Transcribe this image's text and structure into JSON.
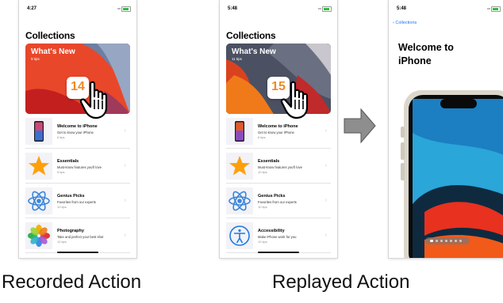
{
  "recorded": {
    "time": "4:27",
    "title": "Collections",
    "hero": {
      "title": "What's New",
      "subtitle": "9 tips",
      "badge": "14"
    },
    "rows": [
      {
        "title": "Welcome to iPhone",
        "subtitle": "Get to know your iPhone",
        "tips": "6 tips",
        "icon": "iphone-icon"
      },
      {
        "title": "Essentials",
        "subtitle": "Must-know features you'll love",
        "tips": "9 tips",
        "icon": "star-icon"
      },
      {
        "title": "Genius Picks",
        "subtitle": "Favorites from our experts",
        "tips": "10 tips",
        "icon": "atom-icon"
      },
      {
        "title": "Photography",
        "subtitle": "Take and perfect your best shot",
        "tips": "10 tips",
        "icon": "photos-icon"
      }
    ]
  },
  "replayed": {
    "time": "5:48",
    "title": "Collections",
    "hero": {
      "title": "What's New",
      "subtitle": "11 tips",
      "badge": "15"
    },
    "rows": [
      {
        "title": "Welcome to iPhone",
        "subtitle": "Get to know your iPhone",
        "tips": "6 tips",
        "icon": "iphone-icon"
      },
      {
        "title": "Essentials",
        "subtitle": "Must-know features you'll love",
        "tips": "10 tips",
        "icon": "star-icon"
      },
      {
        "title": "Genius Picks",
        "subtitle": "Favorites from our experts",
        "tips": "10 tips",
        "icon": "atom-icon"
      },
      {
        "title": "Accessibility",
        "subtitle": "Make iPhone work for you",
        "tips": "10 tips",
        "icon": "accessibility-icon"
      }
    ]
  },
  "result": {
    "time": "5:48",
    "back_label": "Collections",
    "welcome_title": "Welcome to iPhone"
  },
  "captions": {
    "recorded": "Recorded Action",
    "replayed": "Replayed Action"
  },
  "colors": {
    "accent": "#1677ff",
    "star": "#ff9f0a",
    "atom": "#3a86d9",
    "hero_red": "#e2381f"
  }
}
